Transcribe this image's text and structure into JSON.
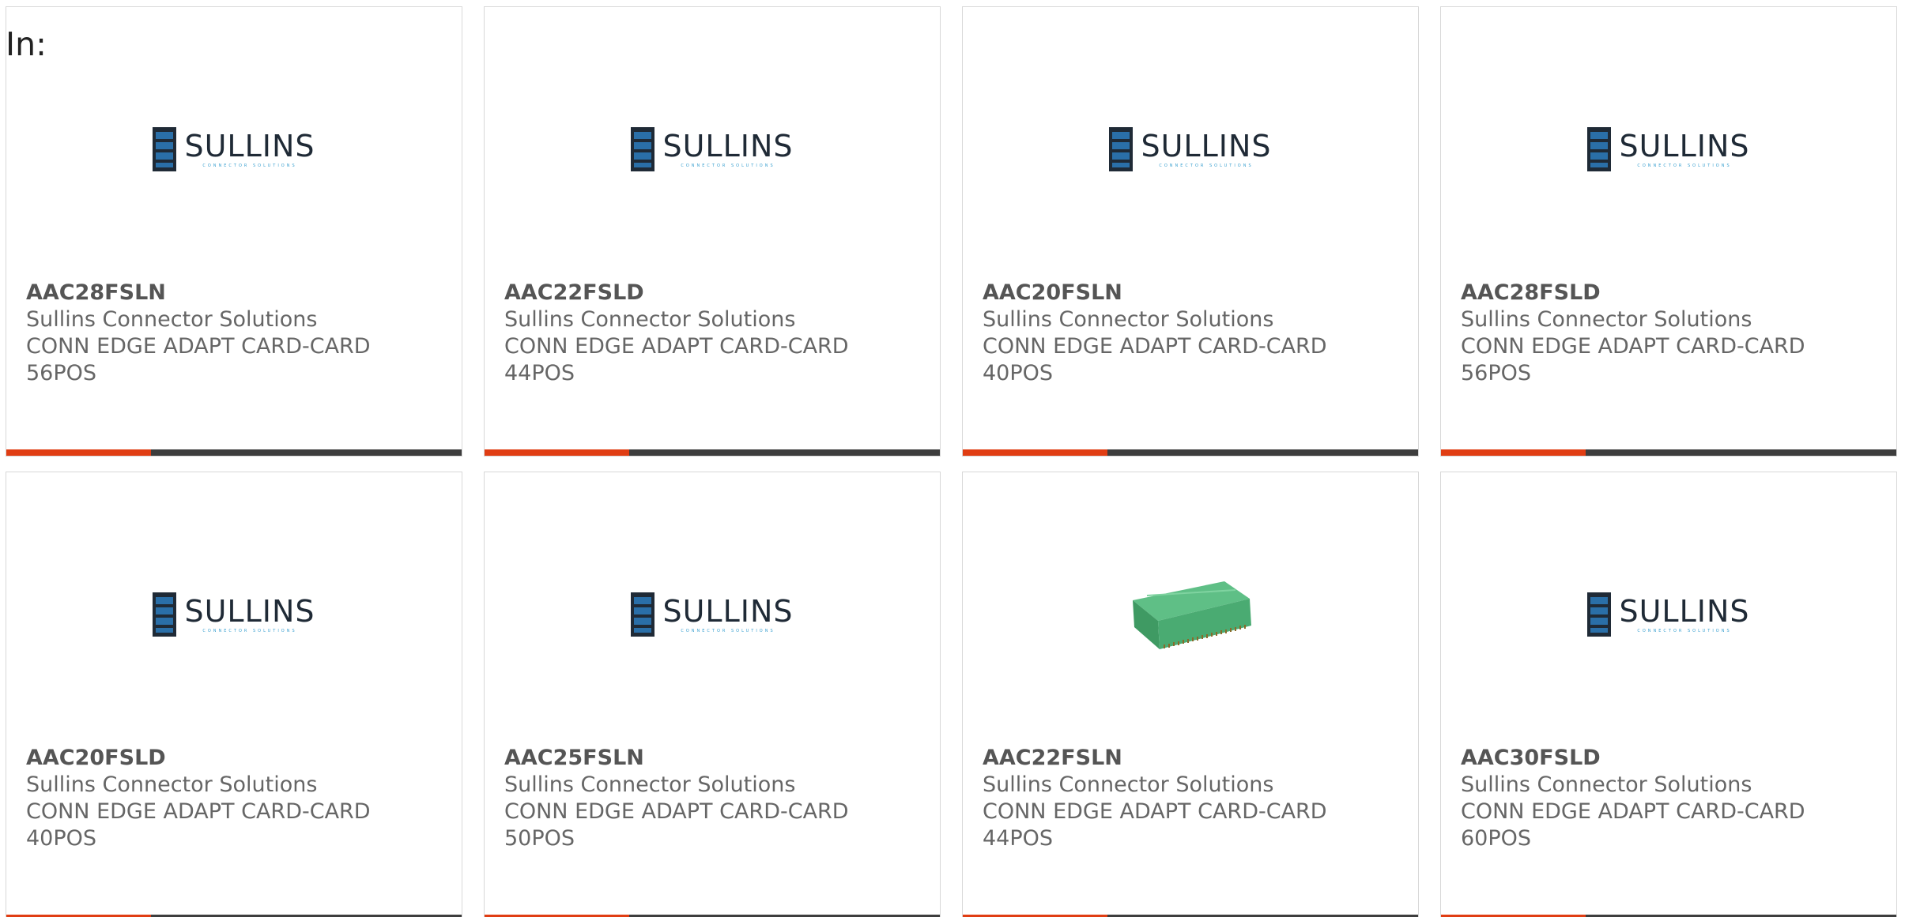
{
  "header": {
    "in_label": "In:"
  },
  "brand": {
    "logo_name": "SULLINS",
    "logo_tagline": "CONNECTOR SOLUTIONS"
  },
  "colors": {
    "accent": "#e03d13",
    "bar": "#3d3d3d",
    "logo_blue": "#2a6fa8"
  },
  "products": [
    {
      "part": "AAC28FSLN",
      "manufacturer": "Sullins Connector Solutions",
      "description": "CONN EDGE ADAPT CARD-CARD",
      "positions": "56POS",
      "image": "sullins-logo"
    },
    {
      "part": "AAC22FSLD",
      "manufacturer": "Sullins Connector Solutions",
      "description": "CONN EDGE ADAPT CARD-CARD",
      "positions": "44POS",
      "image": "sullins-logo"
    },
    {
      "part": "AAC20FSLN",
      "manufacturer": "Sullins Connector Solutions",
      "description": "CONN EDGE ADAPT CARD-CARD",
      "positions": "40POS",
      "image": "sullins-logo"
    },
    {
      "part": "AAC28FSLD",
      "manufacturer": "Sullins Connector Solutions",
      "description": "CONN EDGE ADAPT CARD-CARD",
      "positions": "56POS",
      "image": "sullins-logo"
    },
    {
      "part": "AAC20FSLD",
      "manufacturer": "Sullins Connector Solutions",
      "description": "CONN EDGE ADAPT CARD-CARD",
      "positions": "40POS",
      "image": "sullins-logo"
    },
    {
      "part": "AAC25FSLN",
      "manufacturer": "Sullins Connector Solutions",
      "description": "CONN EDGE ADAPT CARD-CARD",
      "positions": "50POS",
      "image": "sullins-logo"
    },
    {
      "part": "AAC22FSLN",
      "manufacturer": "Sullins Connector Solutions",
      "description": "CONN EDGE ADAPT CARD-CARD",
      "positions": "44POS",
      "image": "connector-photo"
    },
    {
      "part": "AAC30FSLD",
      "manufacturer": "Sullins Connector Solutions",
      "description": "CONN EDGE ADAPT CARD-CARD",
      "positions": "60POS",
      "image": "sullins-logo"
    }
  ]
}
